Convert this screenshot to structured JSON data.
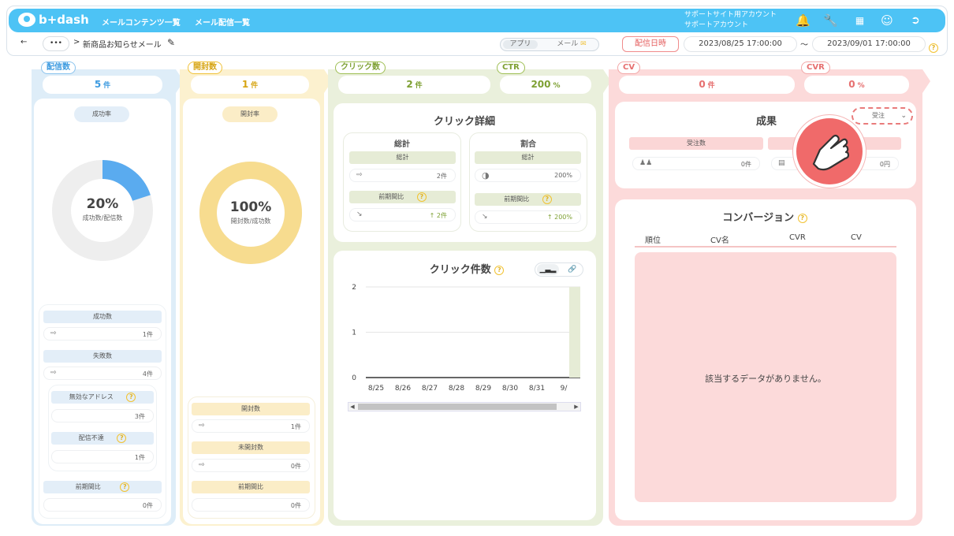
{
  "app": {
    "logo": "b+dash"
  },
  "nav": {
    "contents": "メールコンテンツ一覧",
    "delivery": "メール配信一覧"
  },
  "account": {
    "line1": "サポートサイト用アカウント",
    "line2": "サポートアカウント"
  },
  "breadcrumb": {
    "back": "←",
    "dots": "•••",
    "sep": ">",
    "title": "新商品お知らせメール"
  },
  "toolbar": {
    "app_tab": "アプリ",
    "mail_tab": "メール",
    "date_button": "配信日時",
    "start": "2023/08/25 17:00:00",
    "tilde": "～",
    "end": "2023/09/01 17:00:00"
  },
  "delivery": {
    "tag": "配信数",
    "value": "5",
    "unit": "件",
    "rate_label": "成功率",
    "donut_pct": "20%",
    "donut_sub": "成功数/配信数",
    "donut_fraction": 0.2,
    "success_label": "成功数",
    "success_val": "1件",
    "fail_label": "失敗数",
    "fail_val": "4件",
    "invalid_label": "無効なアドレス",
    "invalid_val": "3件",
    "unreach_label": "配信不達",
    "unreach_val": "1件",
    "prev_label": "前期間比",
    "prev_val": "0件"
  },
  "open": {
    "tag": "開封数",
    "value": "1",
    "unit": "件",
    "rate_label": "開封率",
    "donut_pct": "100%",
    "donut_sub": "開封数/成功数",
    "donut_fraction": 1.0,
    "opened_label": "開封数",
    "opened_val": "1件",
    "unopened_label": "未開封数",
    "unopened_val": "0件",
    "prev_label": "前期間比",
    "prev_val": "0件"
  },
  "click": {
    "tag": "クリック数",
    "value": "2",
    "unit": "件",
    "ctr_tag": "CTR",
    "ctr_value": "200",
    "ctr_unit": "%",
    "detail_title": "クリック詳細",
    "total_title": "総計",
    "ratio_title": "割合",
    "sum_label": "総計",
    "sum_val": "2件",
    "ratio_sum_label": "総計",
    "ratio_val": "200%",
    "prev_label": "前期間比",
    "prev_val": "↑ 2件",
    "ratio_prev_label": "前期間比",
    "ratio_prev_val": "↑ 200%",
    "chart_title": "クリック件数"
  },
  "cv": {
    "tag": "CV",
    "value": "0",
    "unit": "件",
    "cvr_tag": "CVR",
    "cvr_value": "0",
    "cvr_unit": "%",
    "result_title": "成果",
    "select": "受注",
    "order_label": "受注数",
    "order_val": "0件",
    "amount_val": "0円",
    "conv_title": "コンバージョン",
    "col_rank": "順位",
    "col_name": "CV名",
    "col_cvr": "CVR",
    "col_cv": "CV",
    "empty": "該当するデータがありません。"
  },
  "chart_data": {
    "type": "bar",
    "title": "クリック件数",
    "categories": [
      "8/25",
      "8/26",
      "8/27",
      "8/28",
      "8/29",
      "8/30",
      "8/31",
      "9/"
    ],
    "values": [
      0,
      0,
      0,
      0,
      0,
      0,
      0,
      2
    ],
    "ylim": [
      0,
      2
    ],
    "yticks": [
      "0",
      "1",
      "2"
    ],
    "color": "#e6ecd6"
  },
  "colors": {
    "blue": "#5aabef",
    "yellow": "#f7dc8f",
    "green": "#e6ecd6",
    "pink": "#fbd6d6"
  }
}
